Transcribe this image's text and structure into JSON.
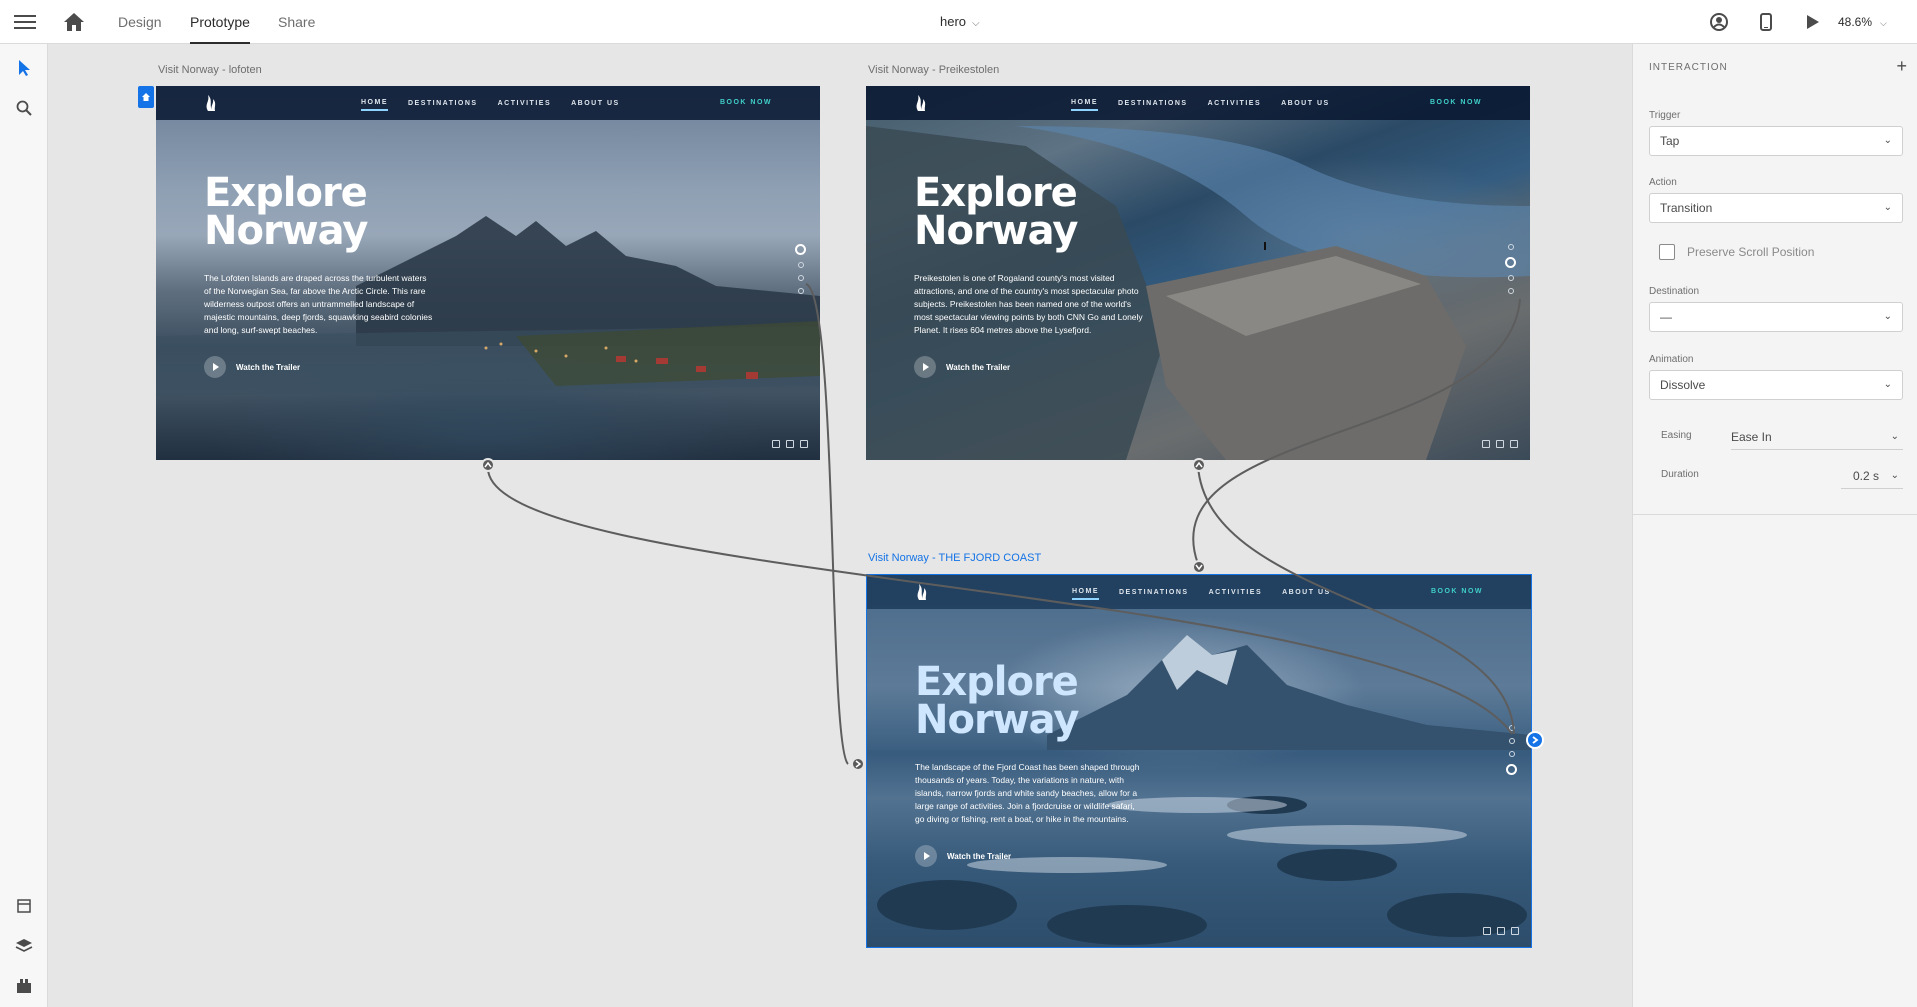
{
  "topbar": {
    "tabs": [
      {
        "label": "Design"
      },
      {
        "label": "Prototype"
      },
      {
        "label": "Share"
      }
    ],
    "doc_title": "hero",
    "zoom": "48.6%"
  },
  "artboards": [
    {
      "label": "Visit Norway - lofoten",
      "nav": [
        "HOME",
        "DESTINATIONS",
        "ACTIVITIES",
        "ABOUT US"
      ],
      "book": "BOOK NOW",
      "hero": [
        "Explore",
        "Norway"
      ],
      "body": "The Lofoten Islands are draped across the turbulent waters of the Norwegian Sea, far above the Arctic Circle. This rare wilderness outpost offers an untrammelled landscape of majestic mountains, deep fjords, squawking seabird colonies and long, surf-swept beaches.",
      "trailer": "Watch the Trailer"
    },
    {
      "label": "Visit Norway - Preikestolen",
      "nav": [
        "HOME",
        "DESTINATIONS",
        "ACTIVITIES",
        "ABOUT US"
      ],
      "book": "BOOK NOW",
      "hero": [
        "Explore",
        "Norway"
      ],
      "body": "Preikestolen is one of Rogaland county's most visited attractions, and one of the country's most spectacular photo subjects. Preikestolen has been named one of the world's most spectacular viewing points by both CNN Go and Lonely Planet. It rises 604 metres above the Lysefjord.",
      "trailer": "Watch the Trailer"
    },
    {
      "label": "Visit Norway - THE FJORD COAST",
      "nav": [
        "HOME",
        "DESTINATIONS",
        "ACTIVITIES",
        "ABOUT US"
      ],
      "book": "BOOK NOW",
      "hero": [
        "Explore",
        "Norway"
      ],
      "body": "The landscape of the Fjord Coast has been shaped through thousands of years. Today, the variations in nature, with islands, narrow fjords and white sandy beaches, allow for a large range of activities. Join a fjordcruise or wildlife safari, go diving or fishing, rent a boat, or hike in the mountains.",
      "trailer": "Watch the Trailer"
    }
  ],
  "panel": {
    "title": "INTERACTION",
    "trigger_label": "Trigger",
    "trigger_value": "Tap",
    "action_label": "Action",
    "action_value": "Transition",
    "preserve_scroll": "Preserve Scroll Position",
    "destination_label": "Destination",
    "destination_value": "—",
    "animation_label": "Animation",
    "animation_value": "Dissolve",
    "easing_label": "Easing",
    "easing_value": "Ease In",
    "duration_label": "Duration",
    "duration_value": "0.2 s"
  },
  "colors": {
    "accent": "#1473e6",
    "book_now": "#3fd0c9",
    "nav_bg": "#081630"
  }
}
